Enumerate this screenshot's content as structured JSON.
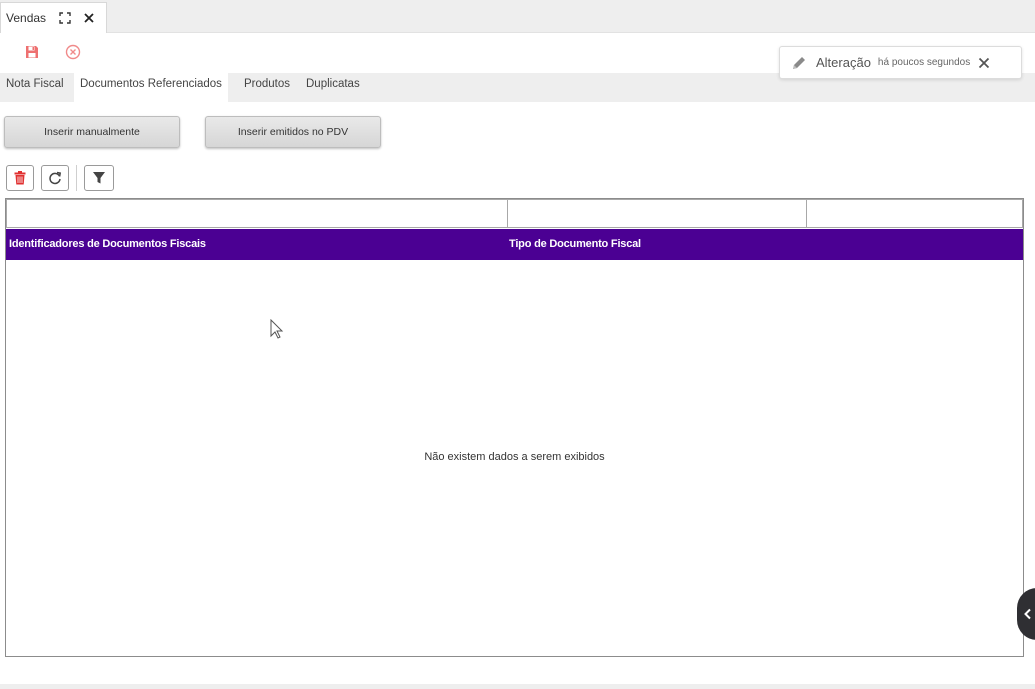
{
  "window_tab": {
    "title": "Vendas",
    "icons": [
      "expand-icon",
      "close-icon"
    ]
  },
  "toolbar": {
    "save_icon": "floppy-disk-icon",
    "cancel_icon": "cancel-circle-icon",
    "save_color": "#e85a5a",
    "cancel_color": "#f08a8a"
  },
  "notification": {
    "icon": "pencil-icon",
    "title": "Alteração",
    "time": "há poucos segundos",
    "close_icon": "close-icon"
  },
  "subtabs": {
    "items": [
      {
        "label": "Nota Fiscal",
        "active": false
      },
      {
        "label": "Documentos Referenciados",
        "active": true
      },
      {
        "label": "Produtos",
        "active": false
      },
      {
        "label": "Duplicatas",
        "active": false
      }
    ]
  },
  "actions": {
    "insert_manual": "Inserir manualmente",
    "insert_pdv": "Inserir emitidos no PDV"
  },
  "grid_tools": {
    "delete_icon": "trash-icon",
    "refresh_icon": "refresh-icon",
    "filter_icon": "funnel-icon"
  },
  "grid": {
    "columns": [
      "Identificadores de Documentos Fiscais",
      "Tipo de Documento Fiscal"
    ],
    "empty_message": "Não existem dados a serem exibidos",
    "header_color": "#4b0093"
  }
}
